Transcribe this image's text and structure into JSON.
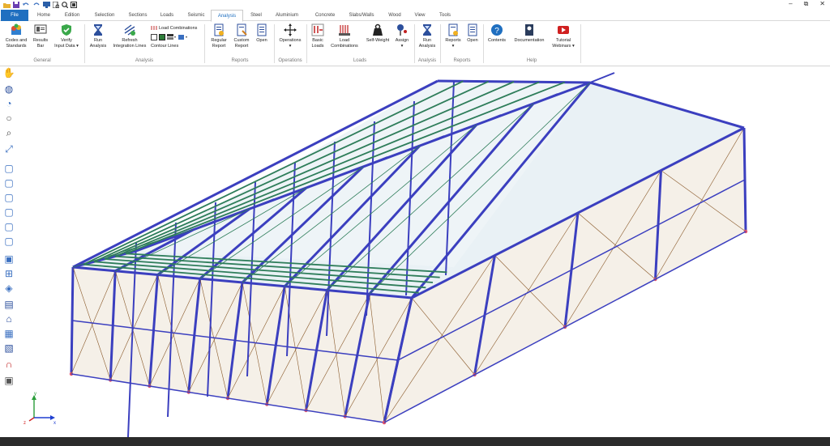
{
  "quick_access": {
    "icons": [
      "folder-icon",
      "save-icon",
      "undo-icon",
      "redo-icon",
      "monitor-icon",
      "print-preview-icon",
      "zoom-icon",
      "window-icon"
    ]
  },
  "tabs": [
    {
      "label": "File",
      "state": "file"
    },
    {
      "label": "Home",
      "state": ""
    },
    {
      "label": "Edition",
      "state": ""
    },
    {
      "label": "Selection",
      "state": ""
    },
    {
      "label": "Sections",
      "state": ""
    },
    {
      "label": "Loads",
      "state": ""
    },
    {
      "label": "Seismic",
      "state": ""
    },
    {
      "label": "Analysis",
      "state": "active"
    },
    {
      "label": "Steel",
      "state": ""
    },
    {
      "label": "Aluminium",
      "state": ""
    },
    {
      "label": "Concrete",
      "state": ""
    },
    {
      "label": "Slabs/Walls",
      "state": ""
    },
    {
      "label": "Wood",
      "state": ""
    },
    {
      "label": "View",
      "state": ""
    },
    {
      "label": "Tools",
      "state": ""
    }
  ],
  "ribbon": {
    "general": {
      "label": "General",
      "codes": "Codes and\nStandards",
      "results_bar": "Results\nBar",
      "verify": "Verify\nInput Data ▾"
    },
    "analysis": {
      "label": "Analysis",
      "run": "Run\nAnalysis",
      "refresh": "Refresh\nIntegration Lines",
      "load_combinations": "Load Combinations",
      "contour_lines": "Contour Lines"
    },
    "reports": {
      "label": "Reports",
      "regular": "Regular\nReport",
      "custom": "Custom\nReport",
      "open": "Open"
    },
    "operations": {
      "label": "Operations",
      "operations": "Operations\n▾"
    },
    "loads": {
      "label": "Loads",
      "basic": "Basic\nLoads",
      "load_comb": "Load\nCombinations",
      "self_weight": "Self-Weight",
      "assign": "Assign\n▾"
    },
    "analysis2": {
      "label": "Analysis",
      "run": "Run\nAnalysis"
    },
    "reports2": {
      "label": "Reports",
      "reports": "Reports\n▾",
      "open": "Open"
    },
    "help": {
      "label": "Help",
      "contents": "Contents",
      "documentation": "Documentation",
      "tutorial": "Tutorial\nWebinars ▾"
    }
  },
  "left_tools": [
    "hand-icon",
    "globe-icon",
    "orbit-icon",
    "rotate-icon",
    "zoom-window-icon",
    "zoom-fit-icon",
    "view-front-icon",
    "view-back-icon",
    "view-left-icon",
    "view-right-icon",
    "view-top-icon",
    "view-bottom-icon",
    "view-iso-icon",
    "grid-view-icon",
    "section-view-icon",
    "render-icon",
    "structure-icon",
    "wall-icon",
    "slab-icon",
    "magnet-icon",
    "frame-icon"
  ],
  "axes": {
    "x": "x",
    "y": "y",
    "z": "z"
  },
  "colors": {
    "accent": "#1f6fc0",
    "member": "#3b3fbf",
    "brace": "#2e7d5a",
    "cladding_x": "#8a5a2b",
    "wall_fill": "#efe6d8",
    "roof_fill": "#cfe0e8",
    "support": "#e0506a"
  }
}
